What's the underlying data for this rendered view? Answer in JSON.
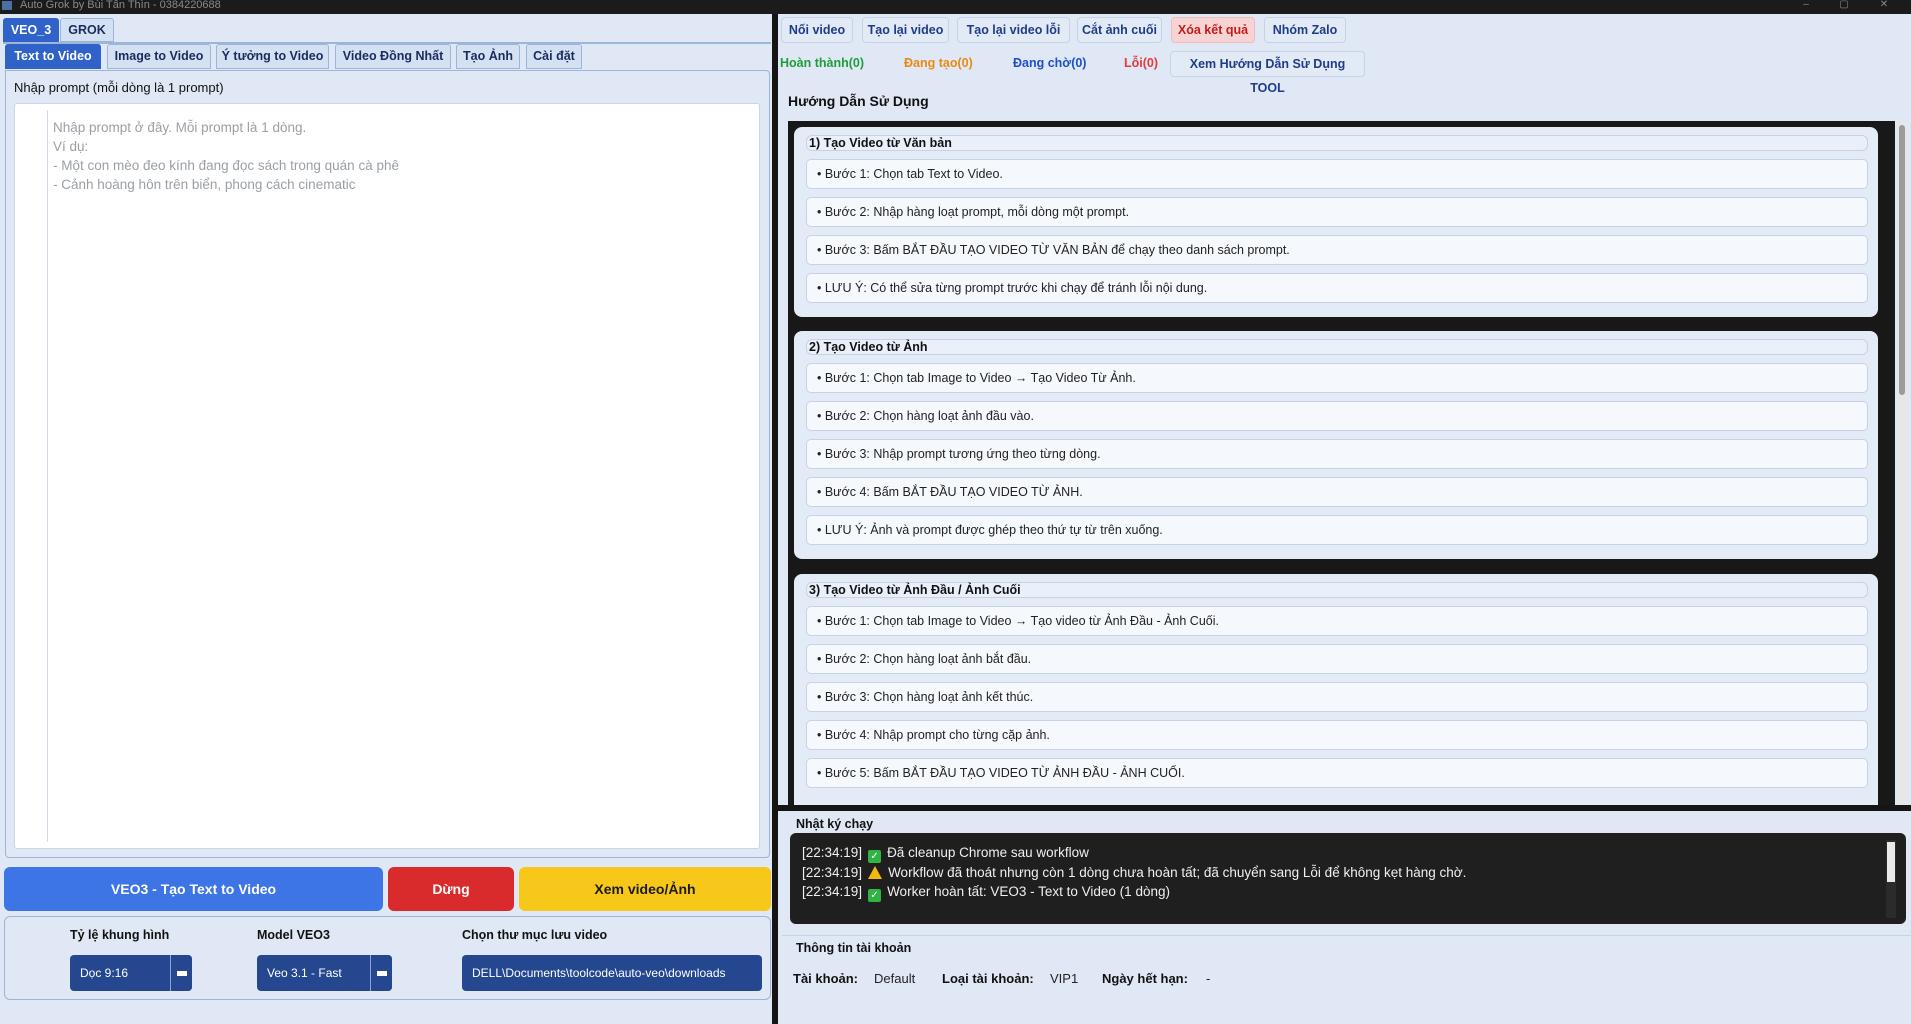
{
  "window": {
    "title": "Auto Grok by Bùi Tấn Thìn - 0384220688"
  },
  "top_tabs": [
    {
      "label": "VEO_3",
      "active": true
    },
    {
      "label": "GROK",
      "active": false
    }
  ],
  "sub_tabs": [
    {
      "label": "Text to Video",
      "active": true
    },
    {
      "label": "Image to Video",
      "active": false
    },
    {
      "label": "Ý tưởng to Video",
      "active": false
    },
    {
      "label": "Video Đồng Nhất",
      "active": false
    },
    {
      "label": "Tạo Ảnh",
      "active": false
    },
    {
      "label": "Cài đặt",
      "active": false
    }
  ],
  "prompt": {
    "label": "Nhập prompt (mỗi dòng là 1 prompt)",
    "placeholder": "Nhập prompt ở đây. Mỗi prompt là 1 dòng.\nVí dụ:\n- Một con mèo đeo kính đang đọc sách trong quán cà phê\n- Cảnh hoàng hôn trên biển, phong cách cinematic"
  },
  "actions": {
    "start": "VEO3 - Tạo Text to Video",
    "stop": "Dừng",
    "view": "Xem video/Ảnh"
  },
  "options": {
    "ratio_label": "Tỷ lệ khung hình",
    "ratio_value": "Dọc 9:16",
    "model_label": "Model VEO3",
    "model_value": "Veo 3.1 - Fast",
    "folder_label": "Chọn thư mục lưu video",
    "folder_value": "DELL\\Documents\\toolcode\\auto-veo\\downloads"
  },
  "toolbar": {
    "merge": "Nối video",
    "retry": "Tạo lại video",
    "retry_failed": "Tạo lại video lỗi",
    "crop_last": "Cắt ảnh cuối",
    "clear": "Xóa kết quả",
    "zalo": "Nhóm Zalo"
  },
  "status": {
    "done": "Hoàn thành(0)",
    "running": "Đang tạo(0)",
    "waiting": "Đang chờ(0)",
    "error": "Lỗi(0)",
    "guide_button": "Xem Hướng Dẫn Sử Dụng TOOL"
  },
  "colors": {
    "done": "#1f9d3a",
    "running": "#e98a12",
    "waiting": "#1f4fc9",
    "error": "#e23b3b",
    "accent": "#2f63c9"
  },
  "guide": {
    "title": "Hướng Dẫn Sử Dụng",
    "sections": [
      {
        "title": "1) Tạo Video từ Văn bản",
        "steps": [
          "• Bước 1: Chọn tab Text to Video.",
          "• Bước 2: Nhập hàng loạt prompt, mỗi dòng một prompt.",
          "• Bước 3: Bấm BẮT ĐẦU TẠO VIDEO TỪ VĂN BẢN để chạy theo danh sách prompt.",
          "• LƯU Ý: Có thể sửa từng prompt trước khi chạy để tránh lỗi nội dung."
        ]
      },
      {
        "title": "2) Tạo Video từ Ảnh",
        "steps": [
          "• Bước 1: Chọn tab Image to Video → Tạo Video Từ Ảnh.",
          "• Bước 2: Chọn hàng loạt ảnh đầu vào.",
          "• Bước 3: Nhập prompt tương ứng theo từng dòng.",
          "• Bước 4: Bấm BẮT ĐẦU TẠO VIDEO TỪ ẢNH.",
          "• LƯU Ý: Ảnh và prompt được ghép theo thứ tự từ trên xuống."
        ]
      },
      {
        "title": "3) Tạo Video từ Ảnh Đầu / Ảnh Cuối",
        "steps": [
          "• Bước 1: Chọn tab Image to Video → Tạo video từ Ảnh Đầu - Ảnh Cuối.",
          "• Bước 2: Chọn hàng loạt ảnh bắt đầu.",
          "• Bước 3: Chọn hàng loạt ảnh kết thúc.",
          "• Bước 4: Nhập prompt cho từng cặp ảnh.",
          "• Bước 5: Bấm BẮT ĐẦU TẠO VIDEO TỪ ẢNH ĐẦU - ẢNH CUỐI."
        ]
      }
    ]
  },
  "log": {
    "label": "Nhật ký chạy",
    "lines": [
      {
        "time": "[22:34:19]",
        "icon": "check-icon",
        "text": "Đã cleanup Chrome sau workflow"
      },
      {
        "time": "[22:34:19]",
        "icon": "warning-icon",
        "text": "Workflow đã thoát nhưng còn 1 dòng chưa hoàn tất; đã chuyển sang Lỗi để không kẹt hàng chờ."
      },
      {
        "time": "[22:34:19]",
        "icon": "check-icon",
        "text": "Worker hoàn tất: VEO3 - Text to Video (1 dòng)"
      }
    ]
  },
  "account": {
    "title": "Thông tin tài khoản",
    "account_label": "Tài khoản:",
    "account_value": "Default",
    "type_label": "Loại tài khoản:",
    "type_value": "VIP1",
    "expiry_label": "Ngày hết hạn:",
    "expiry_value": "-"
  }
}
